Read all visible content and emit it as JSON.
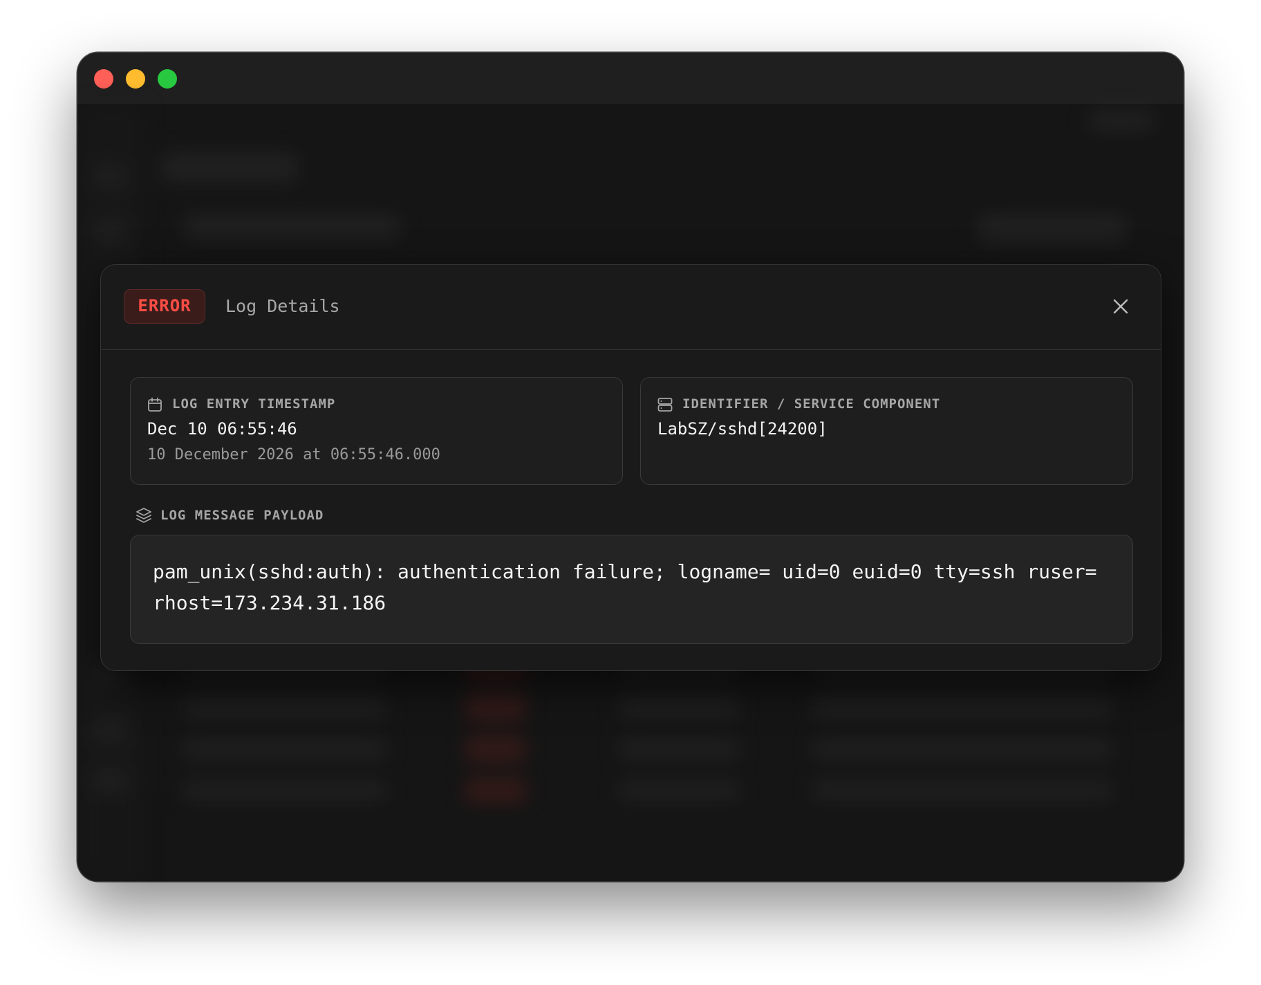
{
  "window": {
    "colors": {
      "close": "#fe5f57",
      "minimize": "#febc2e",
      "zoom": "#28c840"
    }
  },
  "modal": {
    "level_badge": "ERROR",
    "level_color": "#ff4d45",
    "title": "Log Details",
    "close_icon": "close-icon"
  },
  "timestamp": {
    "label": "LOG ENTRY TIMESTAMP",
    "icon": "calendar-icon",
    "value": "Dec 10 06:55:46",
    "full": "10 December 2026 at 06:55:46.000"
  },
  "identifier": {
    "label": "IDENTIFIER / SERVICE COMPONENT",
    "icon": "server-icon",
    "value": "LabSZ/sshd[24200]"
  },
  "payload": {
    "label": "LOG MESSAGE PAYLOAD",
    "icon": "layers-icon",
    "message": "pam_unix(sshd:auth): authentication failure; logname= uid=0 euid=0 tty=ssh ruser= rhost=173.234.31.186"
  }
}
